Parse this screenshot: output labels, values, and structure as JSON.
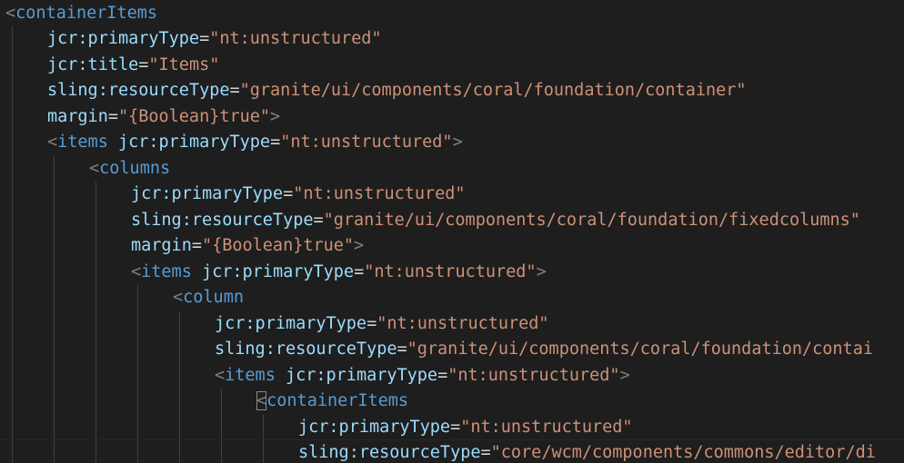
{
  "editor": {
    "language": "xml",
    "colors": {
      "background": "#1e1e1e",
      "bracket": "#808080",
      "tag": "#569cd6",
      "attribute": "#9cdcfe",
      "string": "#ce9178",
      "equals": "#d4d4d4",
      "indent_guide": "#404040"
    },
    "lines": [
      {
        "indent": 0,
        "tokens": [
          [
            "br",
            "<"
          ],
          [
            "tg",
            "containerItems"
          ]
        ]
      },
      {
        "indent": 1,
        "tokens": [
          [
            "at",
            "jcr:primaryType"
          ],
          [
            "eq",
            "="
          ],
          [
            "st",
            "\"nt:unstructured\""
          ]
        ]
      },
      {
        "indent": 1,
        "tokens": [
          [
            "at",
            "jcr:title"
          ],
          [
            "eq",
            "="
          ],
          [
            "st",
            "\"Items\""
          ]
        ]
      },
      {
        "indent": 1,
        "tokens": [
          [
            "at",
            "sling:resourceType"
          ],
          [
            "eq",
            "="
          ],
          [
            "st",
            "\"granite/ui/components/coral/foundation/container\""
          ]
        ]
      },
      {
        "indent": 1,
        "tokens": [
          [
            "at",
            "margin"
          ],
          [
            "eq",
            "="
          ],
          [
            "st",
            "\"{Boolean}true\""
          ],
          [
            "br",
            ">"
          ]
        ]
      },
      {
        "indent": 1,
        "tokens": [
          [
            "br",
            "<"
          ],
          [
            "tg",
            "items"
          ],
          [
            "eq",
            " "
          ],
          [
            "at",
            "jcr:primaryType"
          ],
          [
            "eq",
            "="
          ],
          [
            "st",
            "\"nt:unstructured\""
          ],
          [
            "br",
            ">"
          ]
        ]
      },
      {
        "indent": 2,
        "tokens": [
          [
            "br",
            "<"
          ],
          [
            "tg",
            "columns"
          ]
        ]
      },
      {
        "indent": 3,
        "tokens": [
          [
            "at",
            "jcr:primaryType"
          ],
          [
            "eq",
            "="
          ],
          [
            "st",
            "\"nt:unstructured\""
          ]
        ]
      },
      {
        "indent": 3,
        "tokens": [
          [
            "at",
            "sling:resourceType"
          ],
          [
            "eq",
            "="
          ],
          [
            "st",
            "\"granite/ui/components/coral/foundation/fixedcolumns\""
          ]
        ]
      },
      {
        "indent": 3,
        "tokens": [
          [
            "at",
            "margin"
          ],
          [
            "eq",
            "="
          ],
          [
            "st",
            "\"{Boolean}true\""
          ],
          [
            "br",
            ">"
          ]
        ]
      },
      {
        "indent": 3,
        "tokens": [
          [
            "br",
            "<"
          ],
          [
            "tg",
            "items"
          ],
          [
            "eq",
            " "
          ],
          [
            "at",
            "jcr:primaryType"
          ],
          [
            "eq",
            "="
          ],
          [
            "st",
            "\"nt:unstructured\""
          ],
          [
            "br",
            ">"
          ]
        ]
      },
      {
        "indent": 4,
        "tokens": [
          [
            "br",
            "<"
          ],
          [
            "tg",
            "column"
          ]
        ]
      },
      {
        "indent": 5,
        "tokens": [
          [
            "at",
            "jcr:primaryType"
          ],
          [
            "eq",
            "="
          ],
          [
            "st",
            "\"nt:unstructured\""
          ]
        ]
      },
      {
        "indent": 5,
        "tokens": [
          [
            "at",
            "sling:resourceType"
          ],
          [
            "eq",
            "="
          ],
          [
            "st",
            "\"granite/ui/components/coral/foundation/contai"
          ]
        ]
      },
      {
        "indent": 5,
        "tokens": [
          [
            "br",
            "<"
          ],
          [
            "tg",
            "items"
          ],
          [
            "eq",
            " "
          ],
          [
            "at",
            "jcr:primaryType"
          ],
          [
            "eq",
            "="
          ],
          [
            "st",
            "\"nt:unstructured\""
          ],
          [
            "br",
            ">"
          ]
        ]
      },
      {
        "indent": 6,
        "cursor_bracket": true,
        "tokens": [
          [
            "br",
            "<"
          ],
          [
            "tg",
            "containerItems"
          ]
        ]
      },
      {
        "indent": 7,
        "tokens": [
          [
            "at",
            "jcr:primaryType"
          ],
          [
            "eq",
            "="
          ],
          [
            "st",
            "\"nt:unstructured\""
          ]
        ]
      },
      {
        "indent": 7,
        "tokens": [
          [
            "at",
            "sling:resourceType"
          ],
          [
            "eq",
            "="
          ],
          [
            "st",
            "\"core/wcm/components/commons/editor/di"
          ]
        ]
      }
    ]
  }
}
